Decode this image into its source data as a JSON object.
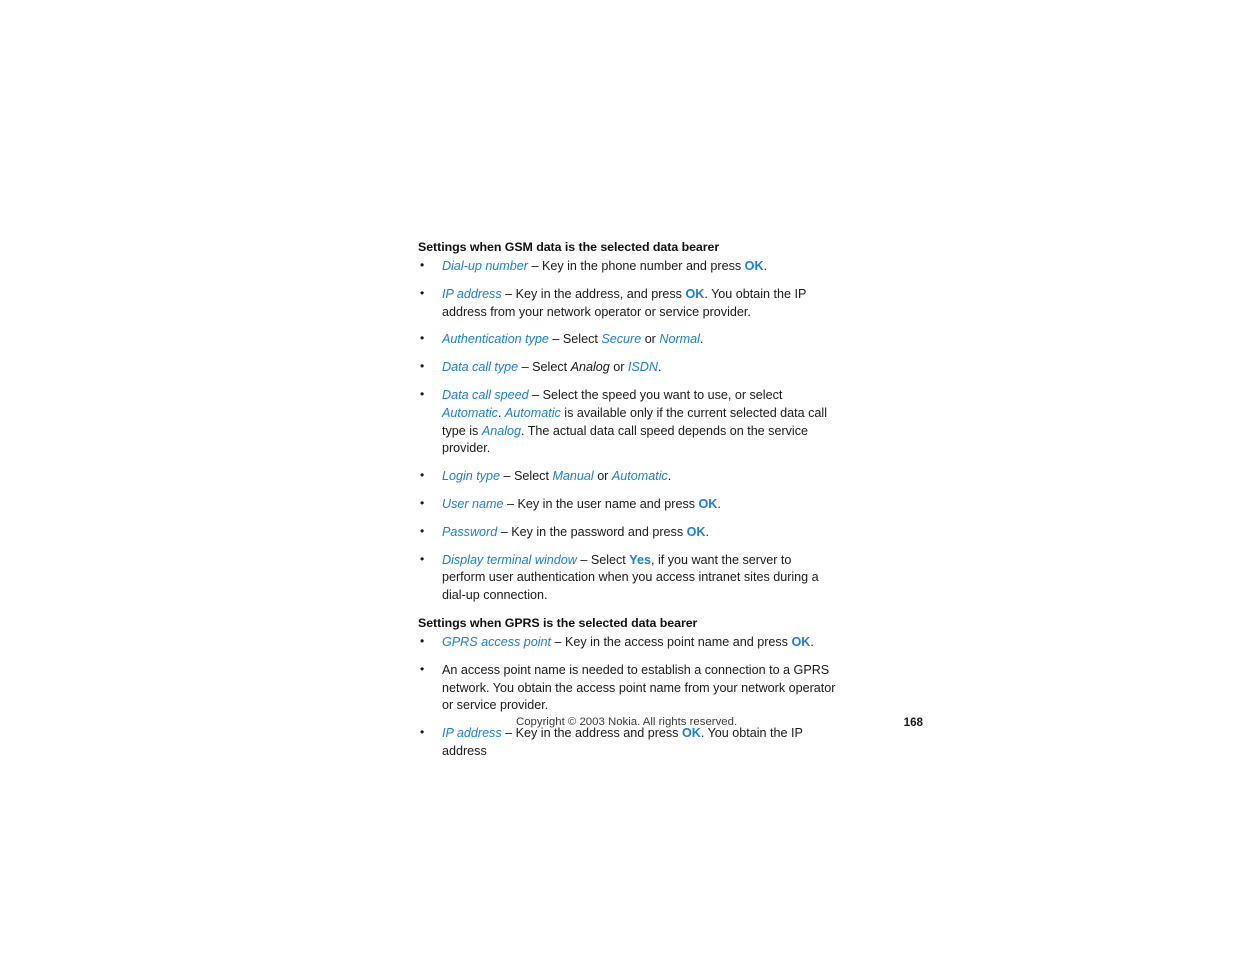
{
  "colors": {
    "accent_blue": "#1a7fd8",
    "body_text": "#1a1a1a",
    "background": "#ffffff"
  },
  "sections": [
    {
      "heading": "Settings when GSM data is the selected data bearer",
      "bullets": [
        {
          "term": "Dial-up number",
          "dash": " – ",
          "text_1": "Key in the phone number and press ",
          "key_1": "OK",
          "text_2": "."
        },
        {
          "term": "IP address",
          "dash": " – ",
          "text_1": "Key in the address, and press ",
          "key_1": "OK",
          "text_2": ". You obtain the IP address from your network operator or service provider."
        },
        {
          "term": "Authentication type",
          "dash": " – ",
          "text_1": "Select ",
          "val_1": "Secure",
          "text_2": " or ",
          "val_2": "Normal",
          "text_3": "."
        },
        {
          "term": "Data call type",
          "dash": " – ",
          "text_1": "Select ",
          "val_dark_1": "Analog",
          "text_2": " or ",
          "val_2": "ISDN",
          "text_3": "."
        },
        {
          "term": "Data call speed",
          "dash": " – ",
          "text_1": "Select the speed you want to use, or select ",
          "val_1": "Automatic",
          "text_2": ". ",
          "val_2": "Automatic",
          "text_3": " is available only if the current selected data call type is ",
          "val_3": "Analog",
          "text_4": ". The actual data call speed depends on the service provider."
        },
        {
          "term": "Login type",
          "dash": " – ",
          "text_1": "Select ",
          "val_1": "Manual",
          "text_2": " or ",
          "val_2": "Automatic",
          "text_3": "."
        },
        {
          "term": "User name",
          "dash": " – ",
          "text_1": "Key in the user name and press ",
          "key_1": "OK",
          "text_2": "."
        },
        {
          "term": "Password",
          "dash": " – ",
          "text_1": "Key in the password and press ",
          "key_1": "OK",
          "text_2": "."
        },
        {
          "term": "Display terminal window",
          "dash": " – ",
          "text_1": "Select ",
          "key_1": "Yes",
          "text_2": ", if you want the server to perform user authentication when you access intranet sites during a dial-up connection."
        }
      ]
    },
    {
      "heading": "Settings when GPRS is the selected data bearer",
      "bullets": [
        {
          "term": "GPRS access point",
          "dash": " – ",
          "text_1": "Key in the access point name and press ",
          "key_1": "OK",
          "text_2": "."
        },
        {
          "plain": "An access point name is needed to establish a connection to a GPRS network. You obtain the access point name from your network operator or service provider."
        },
        {
          "term": "IP address",
          "dash": " – ",
          "text_1": "Key in the address and press ",
          "key_1": "OK",
          "text_2": ". You obtain the IP address"
        }
      ]
    }
  ],
  "footer": {
    "copyright": "Copyright © 2003 Nokia. All rights reserved.",
    "page_number": "168"
  }
}
